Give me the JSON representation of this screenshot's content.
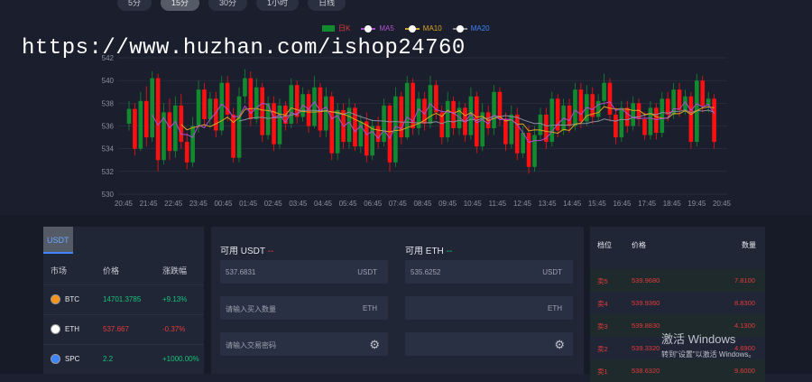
{
  "timeframes": [
    {
      "label": "5分",
      "active": false
    },
    {
      "label": "15分",
      "active": true
    },
    {
      "label": "30分",
      "active": false
    },
    {
      "label": "1小时",
      "active": false
    },
    {
      "label": "日线",
      "active": false
    }
  ],
  "legend": {
    "k": "日K",
    "ma5": "MA5",
    "ma10": "MA10",
    "ma20": "MA20"
  },
  "watermark_text": "https://www.huzhan.com/ishop24760",
  "colors": {
    "up": "#128a2f",
    "down": "#ff1010",
    "ma5": "#b04fd0",
    "ma10": "#d9a520",
    "ma20": "#8a8f9c",
    "accent": "#3d84ff",
    "buy": "#14c27a",
    "sell": "#e23a3a"
  },
  "chart_data": {
    "type": "candlestick",
    "ylim": [
      530,
      542
    ],
    "yticks": [
      "530",
      "532",
      "534",
      "536",
      "538",
      "540",
      "542"
    ],
    "xticks": [
      "20:45",
      "21:45",
      "22:45",
      "23:45",
      "00:45",
      "01:45",
      "02:45",
      "03:45",
      "04:45",
      "05:45",
      "06:45",
      "07:45",
      "08:45",
      "09:45",
      "10:45",
      "11:45",
      "12:45",
      "13:45",
      "14:45",
      "15:45",
      "16:45",
      "17:45",
      "18:45",
      "19:45",
      "20:45"
    ],
    "grid": true,
    "legend_position": "top",
    "candles": [
      {
        "open": 536.2,
        "close": 537.5,
        "high": 538.2,
        "low": 535.6
      },
      {
        "open": 537.5,
        "close": 534.0,
        "high": 538.0,
        "low": 533.4
      },
      {
        "open": 534.0,
        "close": 538.2,
        "high": 539.0,
        "low": 533.8
      },
      {
        "open": 538.2,
        "close": 535.0,
        "high": 539.5,
        "low": 534.2
      },
      {
        "open": 535.0,
        "close": 540.2,
        "high": 540.8,
        "low": 534.6
      },
      {
        "open": 540.2,
        "close": 533.0,
        "high": 540.6,
        "low": 532.0
      },
      {
        "open": 533.0,
        "close": 537.2,
        "high": 538.0,
        "low": 532.6
      },
      {
        "open": 537.2,
        "close": 533.8,
        "high": 538.4,
        "low": 533.0
      },
      {
        "open": 533.8,
        "close": 537.8,
        "high": 538.6,
        "low": 533.2
      },
      {
        "open": 537.8,
        "close": 534.6,
        "high": 538.8,
        "low": 534.0
      },
      {
        "open": 534.6,
        "close": 532.8,
        "high": 535.4,
        "low": 532.2
      },
      {
        "open": 532.8,
        "close": 536.0,
        "high": 536.8,
        "low": 532.4
      },
      {
        "open": 536.0,
        "close": 539.2,
        "high": 540.0,
        "low": 535.4
      },
      {
        "open": 539.2,
        "close": 536.6,
        "high": 539.8,
        "low": 536.0
      },
      {
        "open": 536.6,
        "close": 538.4,
        "high": 539.0,
        "low": 536.0
      },
      {
        "open": 538.4,
        "close": 535.6,
        "high": 539.0,
        "low": 535.0
      },
      {
        "open": 535.6,
        "close": 539.8,
        "high": 540.4,
        "low": 535.2
      },
      {
        "open": 539.8,
        "close": 537.0,
        "high": 540.4,
        "low": 536.4
      },
      {
        "open": 537.0,
        "close": 533.2,
        "high": 537.6,
        "low": 532.8
      },
      {
        "open": 533.2,
        "close": 538.6,
        "high": 539.4,
        "low": 532.8
      },
      {
        "open": 538.6,
        "close": 540.2,
        "high": 541.0,
        "low": 538.0
      },
      {
        "open": 540.2,
        "close": 536.6,
        "high": 540.8,
        "low": 536.0
      },
      {
        "open": 536.6,
        "close": 539.4,
        "high": 540.2,
        "low": 536.2
      },
      {
        "open": 539.4,
        "close": 535.2,
        "high": 539.8,
        "low": 534.6
      },
      {
        "open": 535.2,
        "close": 538.0,
        "high": 538.6,
        "low": 534.8
      },
      {
        "open": 538.0,
        "close": 534.4,
        "high": 538.6,
        "low": 533.8
      },
      {
        "open": 534.4,
        "close": 537.8,
        "high": 538.4,
        "low": 534.0
      },
      {
        "open": 537.8,
        "close": 536.2,
        "high": 538.2,
        "low": 535.6
      },
      {
        "open": 536.2,
        "close": 539.6,
        "high": 540.2,
        "low": 535.8
      },
      {
        "open": 539.6,
        "close": 536.8,
        "high": 540.0,
        "low": 536.2
      },
      {
        "open": 536.8,
        "close": 538.8,
        "high": 539.4,
        "low": 536.4
      },
      {
        "open": 538.8,
        "close": 536.0,
        "high": 539.2,
        "low": 535.4
      },
      {
        "open": 536.0,
        "close": 539.4,
        "high": 540.4,
        "low": 535.8
      },
      {
        "open": 539.4,
        "close": 535.6,
        "high": 539.8,
        "low": 535.0
      },
      {
        "open": 535.6,
        "close": 538.6,
        "high": 539.4,
        "low": 535.0
      },
      {
        "open": 538.6,
        "close": 533.6,
        "high": 539.0,
        "low": 533.0
      },
      {
        "open": 533.6,
        "close": 537.4,
        "high": 538.0,
        "low": 533.0
      },
      {
        "open": 537.4,
        "close": 534.6,
        "high": 538.0,
        "low": 534.0
      },
      {
        "open": 534.6,
        "close": 537.6,
        "high": 538.4,
        "low": 534.0
      },
      {
        "open": 537.6,
        "close": 534.2,
        "high": 538.0,
        "low": 533.8
      },
      {
        "open": 534.2,
        "close": 536.4,
        "high": 537.0,
        "low": 533.6
      },
      {
        "open": 536.4,
        "close": 533.4,
        "high": 537.2,
        "low": 532.8
      },
      {
        "open": 533.4,
        "close": 536.0,
        "high": 536.6,
        "low": 533.0
      },
      {
        "open": 536.0,
        "close": 534.6,
        "high": 536.8,
        "low": 534.0
      },
      {
        "open": 534.6,
        "close": 537.8,
        "high": 538.4,
        "low": 534.2
      },
      {
        "open": 537.8,
        "close": 532.8,
        "high": 538.0,
        "low": 532.0
      },
      {
        "open": 532.8,
        "close": 538.6,
        "high": 539.4,
        "low": 532.4
      },
      {
        "open": 538.6,
        "close": 535.0,
        "high": 539.0,
        "low": 534.4
      },
      {
        "open": 535.0,
        "close": 539.8,
        "high": 540.4,
        "low": 534.8
      },
      {
        "open": 539.8,
        "close": 535.8,
        "high": 540.2,
        "low": 535.2
      },
      {
        "open": 535.8,
        "close": 538.4,
        "high": 539.0,
        "low": 535.2
      },
      {
        "open": 538.4,
        "close": 536.2,
        "high": 539.0,
        "low": 535.6
      },
      {
        "open": 536.2,
        "close": 539.6,
        "high": 540.4,
        "low": 535.8
      },
      {
        "open": 539.6,
        "close": 537.2,
        "high": 540.0,
        "low": 536.6
      },
      {
        "open": 537.2,
        "close": 535.0,
        "high": 537.8,
        "low": 534.4
      },
      {
        "open": 535.0,
        "close": 538.2,
        "high": 539.0,
        "low": 534.6
      },
      {
        "open": 538.2,
        "close": 535.8,
        "high": 538.6,
        "low": 535.2
      },
      {
        "open": 535.8,
        "close": 537.6,
        "high": 538.2,
        "low": 535.2
      },
      {
        "open": 537.6,
        "close": 535.2,
        "high": 538.0,
        "low": 534.6
      },
      {
        "open": 535.2,
        "close": 538.6,
        "high": 539.4,
        "low": 534.8
      },
      {
        "open": 538.6,
        "close": 534.2,
        "high": 539.0,
        "low": 533.6
      },
      {
        "open": 534.2,
        "close": 537.2,
        "high": 538.0,
        "low": 533.8
      },
      {
        "open": 537.2,
        "close": 535.8,
        "high": 537.8,
        "low": 535.2
      },
      {
        "open": 535.8,
        "close": 539.0,
        "high": 539.6,
        "low": 535.2
      },
      {
        "open": 539.0,
        "close": 536.6,
        "high": 539.4,
        "low": 536.0
      },
      {
        "open": 536.6,
        "close": 534.4,
        "high": 537.2,
        "low": 533.8
      },
      {
        "open": 534.4,
        "close": 537.0,
        "high": 537.8,
        "low": 534.0
      },
      {
        "open": 537.0,
        "close": 533.6,
        "high": 537.6,
        "low": 533.0
      },
      {
        "open": 533.6,
        "close": 535.4,
        "high": 536.0,
        "low": 533.2
      },
      {
        "open": 535.4,
        "close": 532.4,
        "high": 536.0,
        "low": 531.8
      },
      {
        "open": 532.4,
        "close": 535.2,
        "high": 536.0,
        "low": 532.0
      },
      {
        "open": 535.2,
        "close": 537.0,
        "high": 537.6,
        "low": 534.8
      },
      {
        "open": 537.0,
        "close": 534.6,
        "high": 537.6,
        "low": 534.0
      },
      {
        "open": 534.6,
        "close": 538.4,
        "high": 539.0,
        "low": 534.2
      },
      {
        "open": 538.4,
        "close": 535.6,
        "high": 538.8,
        "low": 535.0
      },
      {
        "open": 535.6,
        "close": 537.8,
        "high": 538.4,
        "low": 535.2
      },
      {
        "open": 537.8,
        "close": 536.0,
        "high": 538.4,
        "low": 535.4
      },
      {
        "open": 536.0,
        "close": 539.2,
        "high": 539.8,
        "low": 535.6
      },
      {
        "open": 539.2,
        "close": 536.4,
        "high": 539.8,
        "low": 535.8
      },
      {
        "open": 536.4,
        "close": 538.8,
        "high": 539.6,
        "low": 536.0
      },
      {
        "open": 538.8,
        "close": 536.8,
        "high": 539.4,
        "low": 536.2
      },
      {
        "open": 536.8,
        "close": 538.2,
        "high": 538.8,
        "low": 536.4
      },
      {
        "open": 538.2,
        "close": 539.8,
        "high": 540.6,
        "low": 537.8
      },
      {
        "open": 539.8,
        "close": 537.0,
        "high": 540.2,
        "low": 536.4
      },
      {
        "open": 537.0,
        "close": 535.0,
        "high": 537.6,
        "low": 534.4
      },
      {
        "open": 535.0,
        "close": 537.6,
        "high": 538.2,
        "low": 534.6
      },
      {
        "open": 537.6,
        "close": 536.0,
        "high": 538.2,
        "low": 535.4
      },
      {
        "open": 536.0,
        "close": 538.0,
        "high": 538.6,
        "low": 535.6
      },
      {
        "open": 538.0,
        "close": 536.6,
        "high": 538.4,
        "low": 536.0
      },
      {
        "open": 536.6,
        "close": 535.2,
        "high": 537.2,
        "low": 534.8
      },
      {
        "open": 535.2,
        "close": 537.6,
        "high": 538.2,
        "low": 534.8
      },
      {
        "open": 537.6,
        "close": 535.4,
        "high": 538.0,
        "low": 534.8
      },
      {
        "open": 535.4,
        "close": 538.4,
        "high": 539.0,
        "low": 535.0
      },
      {
        "open": 538.4,
        "close": 537.0,
        "high": 539.0,
        "low": 536.4
      },
      {
        "open": 537.0,
        "close": 539.2,
        "high": 539.8,
        "low": 536.6
      },
      {
        "open": 539.2,
        "close": 537.4,
        "high": 539.8,
        "low": 536.8
      },
      {
        "open": 537.4,
        "close": 538.6,
        "high": 539.2,
        "low": 537.0
      },
      {
        "open": 538.6,
        "close": 534.6,
        "high": 539.0,
        "low": 534.0
      },
      {
        "open": 534.6,
        "close": 540.0,
        "high": 540.6,
        "low": 534.2
      },
      {
        "open": 540.0,
        "close": 537.8,
        "high": 540.4,
        "low": 537.2
      },
      {
        "open": 537.8,
        "close": 538.4,
        "high": 539.0,
        "low": 537.2
      },
      {
        "open": 538.4,
        "close": 534.6,
        "high": 538.8,
        "low": 534.0
      }
    ]
  },
  "markets": {
    "tab_label": "USDT",
    "header": {
      "market": "市场",
      "price": "价格",
      "change": "涨跌幅"
    },
    "rows": [
      {
        "symbol": "BTC",
        "price": "14701.3785",
        "change": "+9.13%",
        "trend": "up",
        "icon": "bitcoin-icon",
        "icon_color": "#f7931a"
      },
      {
        "symbol": "ETH",
        "price": "537.667",
        "change": "-0.37%",
        "trend": "down",
        "icon": "ethereum-icon",
        "icon_color": "#ffffff"
      },
      {
        "symbol": "SPC",
        "price": "2.2",
        "change": "+1000.00%",
        "trend": "up",
        "icon": "spc-icon",
        "icon_color": "#3d84ff"
      }
    ]
  },
  "trade": {
    "buy": {
      "avail_label": "可用 USDT",
      "avail_value": "--",
      "price_value": "537.6831",
      "price_unit": "USDT",
      "amount_placeholder": "请输入买入数量",
      "amount_unit": "ETH",
      "password_placeholder": "请输入交易密码"
    },
    "sell": {
      "avail_label": "可用 ETH",
      "avail_value": "--",
      "price_value": "535.6252",
      "price_unit": "USDT",
      "amount_unit": "ETH"
    }
  },
  "orderbook": {
    "header": {
      "level": "档位",
      "price": "价格",
      "qty": "数量"
    },
    "asks": [
      {
        "level": "卖5",
        "price": "539.9680",
        "qty": "7.8100"
      },
      {
        "level": "卖4",
        "price": "539.9360",
        "qty": "8.8300"
      },
      {
        "level": "卖3",
        "price": "539.8830",
        "qty": "4.1300"
      },
      {
        "level": "卖2",
        "price": "539.3320",
        "qty": "4.6900"
      },
      {
        "level": "卖1",
        "price": "538.6320",
        "qty": "9.6000"
      }
    ]
  },
  "windows_activation": {
    "title": "激活 Windows",
    "subtitle": "转到\"设置\"以激活 Windows。"
  }
}
